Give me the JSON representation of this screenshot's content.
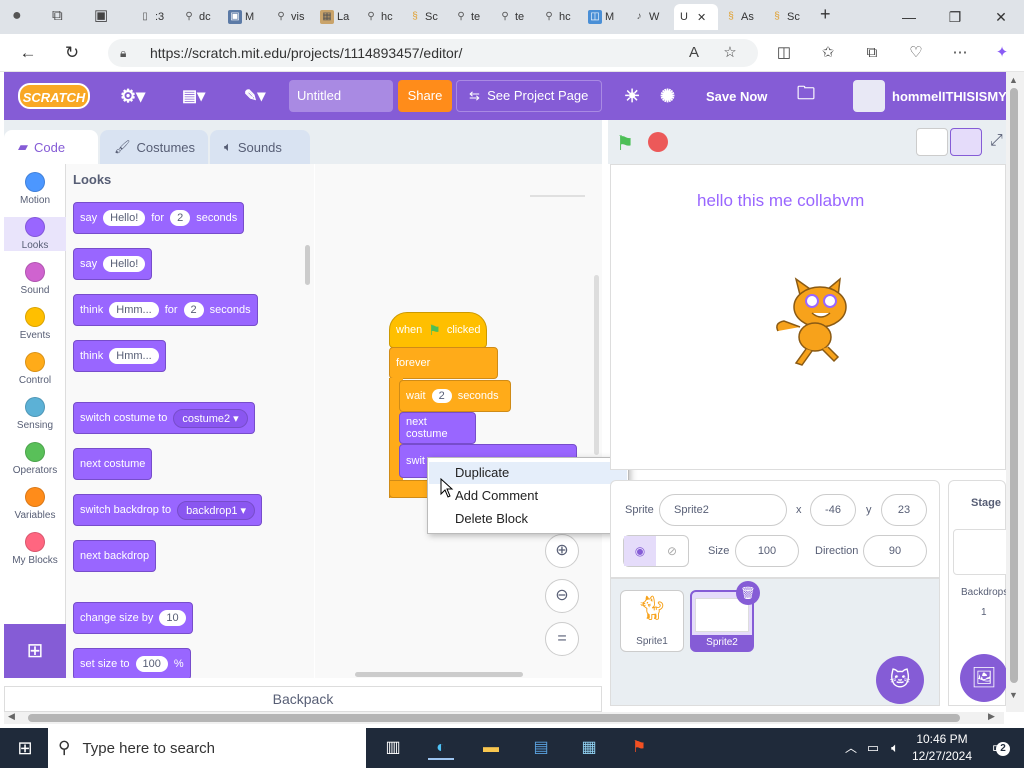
{
  "browser": {
    "tabs": [
      {
        "label": ":3"
      },
      {
        "label": "dc"
      },
      {
        "label": "M"
      },
      {
        "label": "vis"
      },
      {
        "label": "La"
      },
      {
        "label": "hc"
      },
      {
        "label": "Sc"
      },
      {
        "label": "te"
      },
      {
        "label": "te"
      },
      {
        "label": "hc"
      },
      {
        "label": "M"
      },
      {
        "label": "W"
      },
      {
        "label": "U"
      },
      {
        "label": "As"
      },
      {
        "label": "Sc"
      }
    ],
    "active_tab_close": "✕",
    "new_tab": "+",
    "url": "https://scratch.mit.edu/projects/1114893457/editor/"
  },
  "scratch": {
    "logo": "SCRATCH",
    "title": "Untitled",
    "share": "Share",
    "see_project": "See Project Page",
    "save_now": "Save Now",
    "username": "hommelITHISISMY",
    "tabs": {
      "code": "Code",
      "costumes": "Costumes",
      "sounds": "Sounds"
    },
    "categories": [
      {
        "label": "Motion",
        "color": "#4c97ff"
      },
      {
        "label": "Looks",
        "color": "#9966ff"
      },
      {
        "label": "Sound",
        "color": "#cf63cf"
      },
      {
        "label": "Events",
        "color": "#ffbf00"
      },
      {
        "label": "Control",
        "color": "#ffab19"
      },
      {
        "label": "Sensing",
        "color": "#5cb1d6"
      },
      {
        "label": "Operators",
        "color": "#59c059"
      },
      {
        "label": "Variables",
        "color": "#ff8c1a"
      },
      {
        "label": "My Blocks",
        "color": "#ff6680"
      }
    ],
    "palette": {
      "title": "Looks",
      "say_for": {
        "w1": "say",
        "in1": "Hello!",
        "w2": "for",
        "in2": "2",
        "w3": "seconds"
      },
      "say": {
        "w1": "say",
        "in1": "Hello!"
      },
      "think_for": {
        "w1": "think",
        "in1": "Hmm...",
        "w2": "for",
        "in2": "2",
        "w3": "seconds"
      },
      "think": {
        "w1": "think",
        "in1": "Hmm..."
      },
      "switch_costume": {
        "w1": "switch costume to",
        "dd": "costume2"
      },
      "next_costume": "next costume",
      "switch_backdrop": {
        "w1": "switch backdrop to",
        "dd": "backdrop1"
      },
      "next_backdrop": "next backdrop",
      "change_size": {
        "w1": "change size by",
        "in1": "10"
      },
      "set_size": {
        "w1": "set size to",
        "in1": "100",
        "w2": "%"
      }
    },
    "script": {
      "hat_w1": "when",
      "hat_w2": "clicked",
      "forever": "forever",
      "wait_w1": "wait",
      "wait_in": "2",
      "wait_w2": "seconds",
      "next_costume": "next costume",
      "switch_partial": "swit"
    },
    "context_menu": [
      "Duplicate",
      "Add Comment",
      "Delete Block"
    ],
    "backpack": "Backpack",
    "stage_text": "hello this me collabvm",
    "sprite_info": {
      "sprite_label": "Sprite",
      "sprite_name": "Sprite2",
      "x_label": "x",
      "x": "-46",
      "y_label": "y",
      "y": "23",
      "show_label": "Show",
      "size_label": "Size",
      "size": "100",
      "direction_label": "Direction",
      "direction": "90"
    },
    "sprites": [
      "Sprite1",
      "Sprite2"
    ],
    "stage_panel": {
      "title": "Stage",
      "backdrops_label": "Backdrops",
      "backdrops_count": "1"
    }
  },
  "taskbar": {
    "search_placeholder": "Type here to search",
    "time": "10:46 PM",
    "date": "12/27/2024"
  }
}
